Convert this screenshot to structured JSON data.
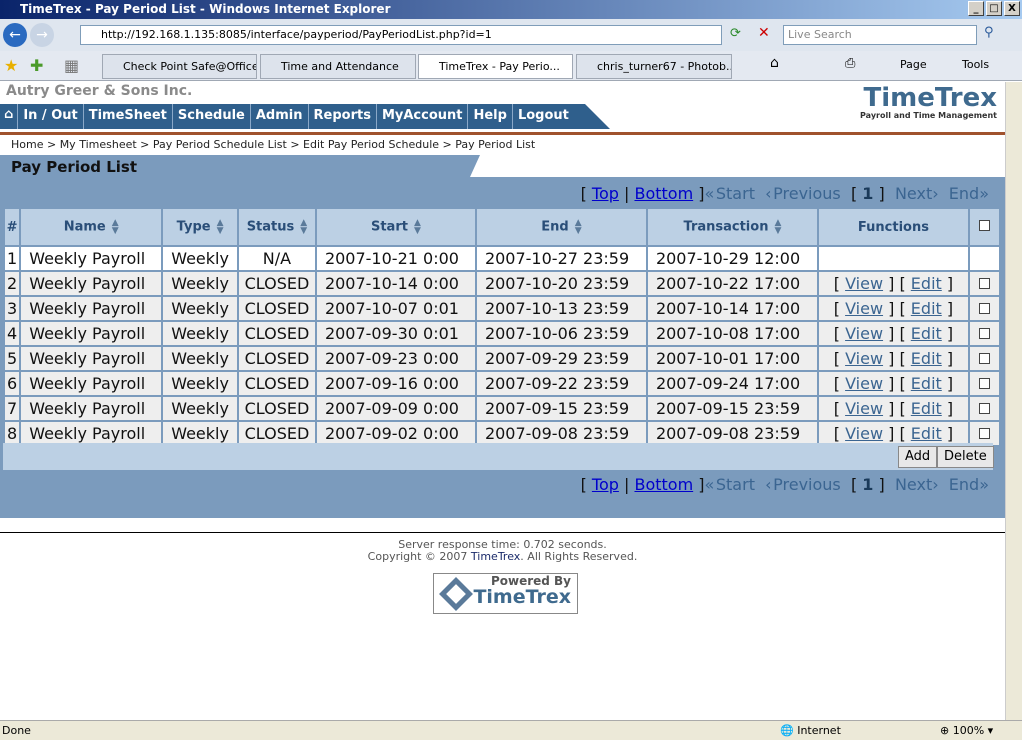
{
  "window": {
    "title": "TimeTrex - Pay Period List - Windows Internet Explorer"
  },
  "browser": {
    "url": "http://192.168.1.135:8085/interface/payperiod/PayPeriodList.php?id=1",
    "search_placeholder": "Live Search",
    "tabs": [
      "Check Point Safe@Office",
      "Time and Attendance",
      "TimeTrex - Pay Perio...",
      "chris_turner67 - Photob..."
    ],
    "tools": {
      "page": "Page",
      "tools": "Tools"
    },
    "status": "Done",
    "zone": "Internet",
    "zoom": "100%"
  },
  "header": {
    "company": "Autry Greer & Sons Inc.",
    "logo": "TimeTrex",
    "logo_tagline": "Payroll and Time Management",
    "nav": [
      "In / Out",
      "TimeSheet",
      "Schedule",
      "Admin",
      "Reports",
      "MyAccount",
      "Help",
      "Logout"
    ]
  },
  "breadcrumb": "Home > My Timesheet > Pay Period Schedule List > Edit Pay Period Schedule > Pay Period List",
  "page_title": "Pay Period List",
  "pager": {
    "top": "Top",
    "bottom": "Bottom",
    "start": "Start",
    "previous": "Previous",
    "page": "1",
    "next": "Next",
    "end": "End"
  },
  "table": {
    "columns": [
      "#",
      "Name",
      "Type",
      "Status",
      "Start",
      "End",
      "Transaction",
      "Functions"
    ],
    "view_label": "View",
    "edit_label": "Edit",
    "rows": [
      [
        "1",
        "Weekly Payroll",
        "Weekly",
        "N/A",
        "2007-10-21 0:00",
        "2007-10-27 23:59",
        "2007-10-29 12:00"
      ],
      [
        "2",
        "Weekly Payroll",
        "Weekly",
        "CLOSED",
        "2007-10-14 0:00",
        "2007-10-20 23:59",
        "2007-10-22 17:00"
      ],
      [
        "3",
        "Weekly Payroll",
        "Weekly",
        "CLOSED",
        "2007-10-07 0:01",
        "2007-10-13 23:59",
        "2007-10-14 17:00"
      ],
      [
        "4",
        "Weekly Payroll",
        "Weekly",
        "CLOSED",
        "2007-09-30 0:01",
        "2007-10-06 23:59",
        "2007-10-08 17:00"
      ],
      [
        "5",
        "Weekly Payroll",
        "Weekly",
        "CLOSED",
        "2007-09-23 0:00",
        "2007-09-29 23:59",
        "2007-10-01 17:00"
      ],
      [
        "6",
        "Weekly Payroll",
        "Weekly",
        "CLOSED",
        "2007-09-16 0:00",
        "2007-09-22 23:59",
        "2007-09-24 17:00"
      ],
      [
        "7",
        "Weekly Payroll",
        "Weekly",
        "CLOSED",
        "2007-09-09 0:00",
        "2007-09-15 23:59",
        "2007-09-15 23:59"
      ],
      [
        "8",
        "Weekly Payroll",
        "Weekly",
        "CLOSED",
        "2007-09-02 0:00",
        "2007-09-08 23:59",
        "2007-09-08 23:59"
      ]
    ]
  },
  "actions": {
    "add": "Add",
    "delete": "Delete"
  },
  "footer": {
    "response": "Server response time: 0.702 seconds.",
    "copyright_pre": "Copyright © 2007 ",
    "brand": "TimeTrex",
    "copyright_post": ". All Rights Reserved.",
    "powered_by": "Powered By",
    "powered_logo": "TimeTrex"
  }
}
